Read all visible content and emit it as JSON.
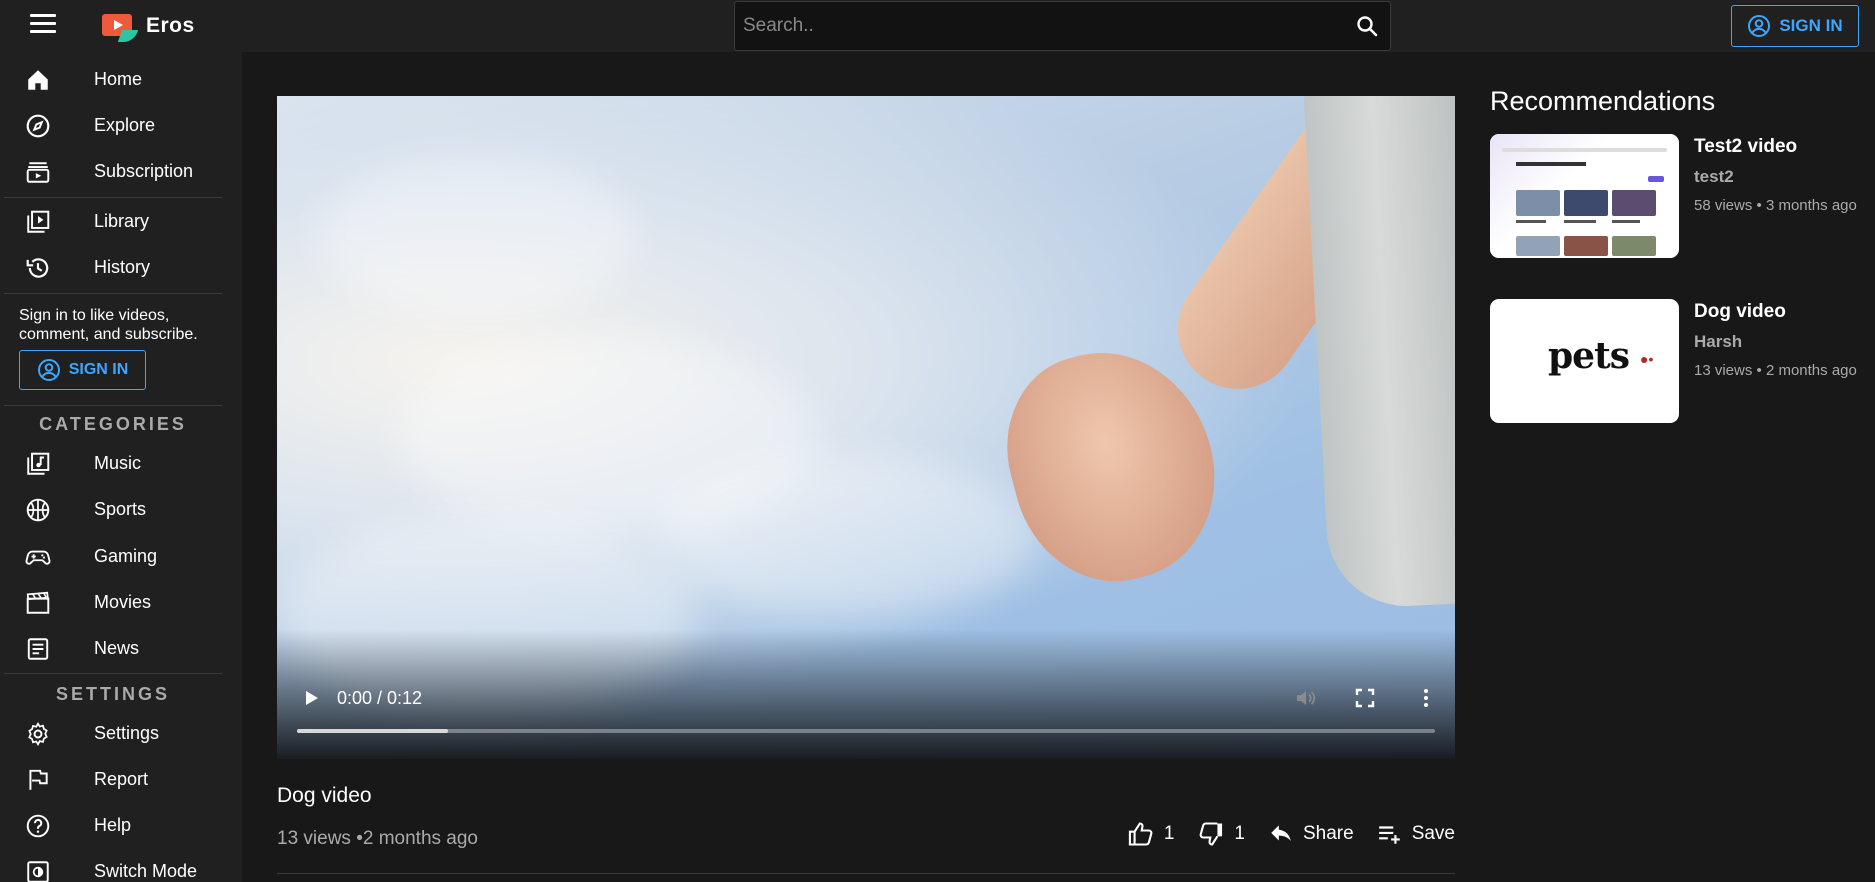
{
  "app": {
    "name": "Eros"
  },
  "search": {
    "placeholder": "Search.."
  },
  "header": {
    "signin_label": "SIGN IN"
  },
  "sidebar": {
    "main": [
      {
        "label": "Home",
        "icon": "home-icon"
      },
      {
        "label": "Explore",
        "icon": "explore-icon"
      },
      {
        "label": "Subscription",
        "icon": "subscription-icon"
      }
    ],
    "library": [
      {
        "label": "Library",
        "icon": "library-icon"
      },
      {
        "label": "History",
        "icon": "history-icon"
      }
    ],
    "signin_message": "Sign in to like videos, comment, and subscribe.",
    "signin_label": "SIGN IN",
    "categories_title": "CATEGORIES",
    "categories": [
      {
        "label": "Music",
        "icon": "music-icon"
      },
      {
        "label": "Sports",
        "icon": "sports-icon"
      },
      {
        "label": "Gaming",
        "icon": "gaming-icon"
      },
      {
        "label": "Movies",
        "icon": "movies-icon"
      },
      {
        "label": "News",
        "icon": "news-icon"
      }
    ],
    "settings_title": "SETTINGS",
    "settings": [
      {
        "label": "Settings",
        "icon": "gear-icon"
      },
      {
        "label": "Report",
        "icon": "flag-icon"
      },
      {
        "label": "Help",
        "icon": "help-icon"
      },
      {
        "label": "Switch Mode",
        "icon": "switch-mode-icon"
      }
    ]
  },
  "player": {
    "timecode": "0:00 / 0:12",
    "progress_fraction": 0.133
  },
  "video": {
    "title": "Dog video",
    "meta": "13 views •2 months ago",
    "likes": "1",
    "dislikes": "1",
    "share_label": "Share",
    "save_label": "Save"
  },
  "recommendations": {
    "heading": "Recommendations",
    "items": [
      {
        "title": "Test2 video",
        "channel": "test2",
        "meta": "58 views • 3 months ago"
      },
      {
        "title": "Dog video",
        "channel": "Harsh",
        "meta": "13 views • 2 months ago",
        "thumb_text": "pets"
      }
    ]
  },
  "colors": {
    "accent": "#3ea6ff",
    "background": "#181818",
    "panel": "#202020"
  }
}
